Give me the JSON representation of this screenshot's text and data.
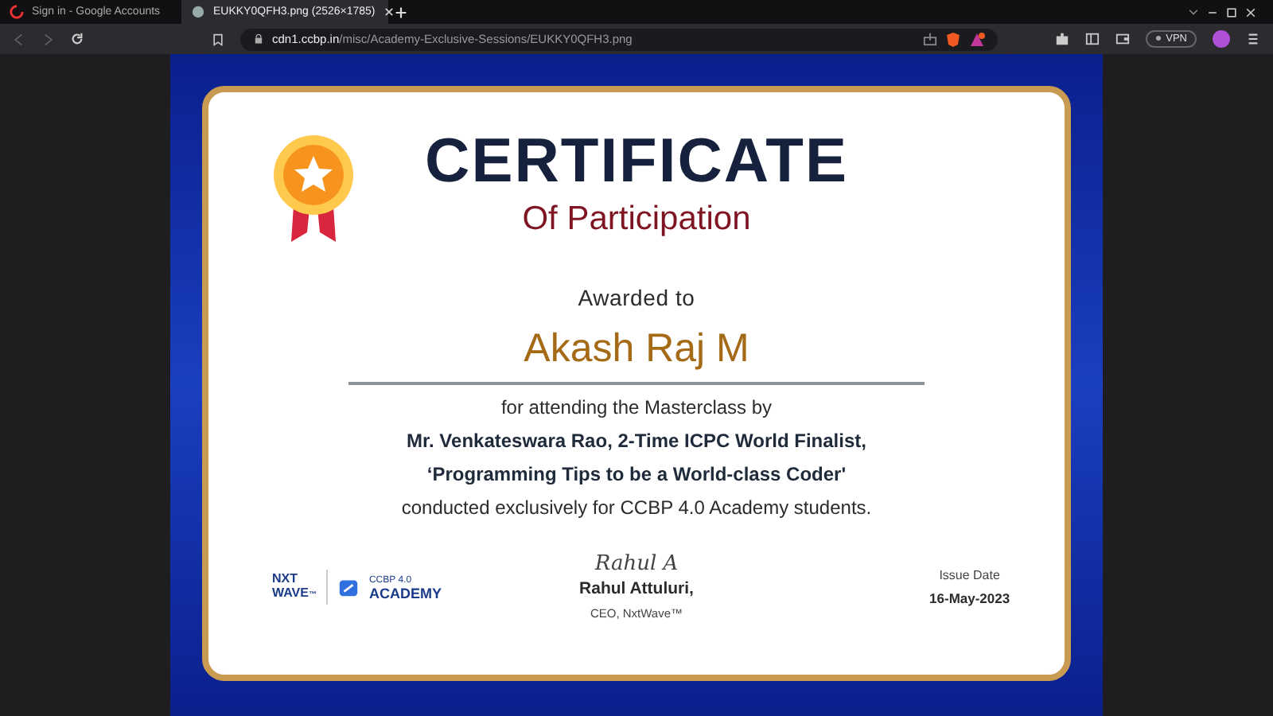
{
  "browser": {
    "tabs": [
      {
        "title": "Sign in - Google Accounts",
        "selected": false
      },
      {
        "title": "EUKKY0QFH3.png (2526×1785)",
        "selected": true
      }
    ],
    "url": {
      "host": "cdn1.ccbp.in",
      "path": "/misc/Academy-Exclusive-Sessions/EUKKY0QFH3.png"
    },
    "vpn_label": "VPN"
  },
  "certificate": {
    "title": "CERTIFICATE",
    "subtitle": "Of Participation",
    "awarded_label": "Awarded to",
    "recipient": "Akash Raj M",
    "lines": [
      {
        "text": "for attending the Masterclass by",
        "kind": "plain"
      },
      {
        "text": "Mr. Venkateswara Rao, 2-Time ICPC World Finalist,",
        "kind": "bold"
      },
      {
        "text": "‘Programming Tips to be a World-class Coder'",
        "kind": "bold"
      },
      {
        "text": "conducted exclusively for CCBP 4.0 Academy students.",
        "kind": "plain"
      }
    ],
    "logo": {
      "nxt": "NXT",
      "wave": "WAVE",
      "tm": "™",
      "academy_top": "CCBP 4.0",
      "academy": "ACADEMY"
    },
    "signature": "Rahul A",
    "signer": "Rahul Attuluri,",
    "signer_role": "CEO, NxtWave™",
    "issue_label": "Issue Date",
    "issue_date": "16-May-2023"
  }
}
